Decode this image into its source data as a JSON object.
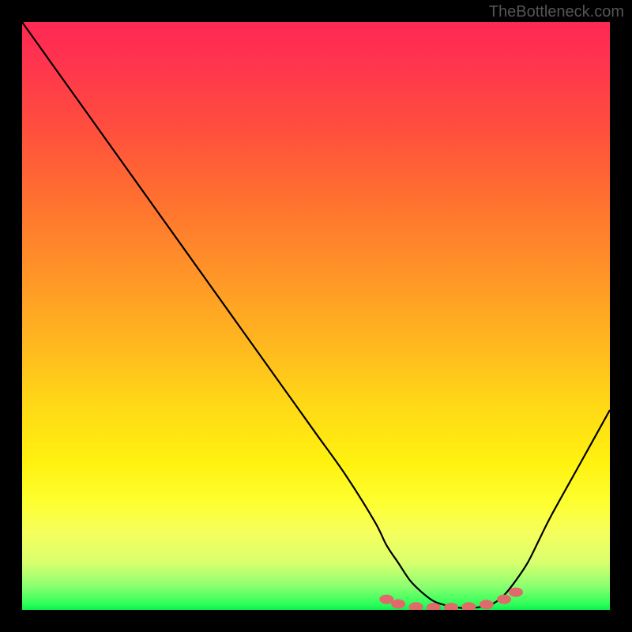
{
  "attribution": "TheBottleneck.com",
  "chart_data": {
    "type": "line",
    "title": "",
    "xlabel": "",
    "ylabel": "",
    "xlim": [
      0,
      100
    ],
    "ylim": [
      0,
      100
    ],
    "series": [
      {
        "name": "bottleneck-curve",
        "x": [
          0,
          5,
          10,
          15,
          20,
          25,
          30,
          35,
          40,
          45,
          50,
          55,
          60,
          62,
          64,
          66,
          68,
          70,
          72,
          74,
          76,
          78,
          80,
          82,
          84,
          86,
          88,
          90,
          95,
          100
        ],
        "y": [
          100,
          93,
          86,
          79,
          72,
          65,
          58,
          51,
          44,
          37,
          30,
          23,
          15,
          11,
          8,
          5,
          3,
          1.5,
          0.8,
          0.4,
          0.3,
          0.5,
          1,
          2.5,
          5,
          8,
          12,
          16,
          25,
          34
        ]
      }
    ],
    "markers": {
      "name": "highlight-dots",
      "color": "#e06a6a",
      "points": [
        {
          "x": 62,
          "y": 1.8
        },
        {
          "x": 64,
          "y": 1.0
        },
        {
          "x": 67,
          "y": 0.5
        },
        {
          "x": 70,
          "y": 0.4
        },
        {
          "x": 73,
          "y": 0.4
        },
        {
          "x": 76,
          "y": 0.5
        },
        {
          "x": 79,
          "y": 0.9
        },
        {
          "x": 82,
          "y": 1.8
        },
        {
          "x": 84,
          "y": 3.0
        }
      ]
    }
  }
}
